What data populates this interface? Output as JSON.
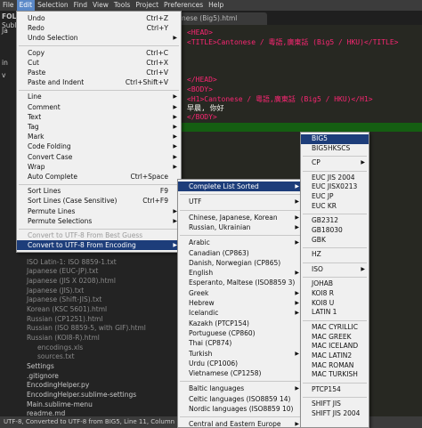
{
  "menubar": [
    "File",
    "Edit",
    "Selection",
    "Find",
    "View",
    "Tools",
    "Project",
    "Preferences",
    "Help"
  ],
  "tab": {
    "title": "nese (Big5).html"
  },
  "sidebar": {
    "folders_label": "FOLD",
    "items": [
      "Subli",
      "Ja",
      "in",
      "v",
      "ISO Latin-1: ISO 8859-1.txt",
      "Japanese (EUC-JP).txt",
      "Japanese (JIS X 0208).html",
      "Japanese (JIS).txt",
      "Japanese (Shift-JIS).txt",
      "Korean (KSC 5601).html",
      "Russian (CP1251).html",
      "Russian (ISO 8859-5, with GIF).html",
      "Russian (KOI8-R).html",
      "encodings.xls",
      "sources.txt",
      "Settings",
      ".gitignore",
      "EncodingHelper.py",
      "EncodingHelper.sublime-settings",
      "Main.sublime-menu",
      "readme.md"
    ]
  },
  "editor": {
    "lines": [
      "<HEAD>",
      "<TITLE>Cantonese / 粵語,廣東話 (Big5 / HKU)</TITLE>",
      "",
      "</HEAD>",
      "<BODY>",
      "<H1>Cantonese / 粵語,廣東話 (Big5 / HKU)</H1>",
      "早晨, 你好",
      "</BODY>"
    ]
  },
  "status": "UTF-8, Converted to UTF-8 from BIG5, Line 11, Column 1",
  "edit_menu": [
    {
      "label": "Undo",
      "sc": "Ctrl+Z"
    },
    {
      "label": "Redo",
      "sc": "Ctrl+Y"
    },
    {
      "label": "Undo Selection",
      "arrow": true
    },
    {
      "sep": true
    },
    {
      "label": "Copy",
      "sc": "Ctrl+C"
    },
    {
      "label": "Cut",
      "sc": "Ctrl+X"
    },
    {
      "label": "Paste",
      "sc": "Ctrl+V"
    },
    {
      "label": "Paste and Indent",
      "sc": "Ctrl+Shift+V"
    },
    {
      "sep": true
    },
    {
      "label": "Line",
      "arrow": true
    },
    {
      "label": "Comment",
      "arrow": true
    },
    {
      "label": "Text",
      "arrow": true
    },
    {
      "label": "Tag",
      "arrow": true
    },
    {
      "label": "Mark",
      "arrow": true
    },
    {
      "label": "Code Folding",
      "arrow": true
    },
    {
      "label": "Convert Case",
      "arrow": true
    },
    {
      "label": "Wrap",
      "arrow": true
    },
    {
      "label": "Auto Complete",
      "sc": "Ctrl+Space"
    },
    {
      "sep": true
    },
    {
      "label": "Sort Lines",
      "sc": "F9"
    },
    {
      "label": "Sort Lines (Case Sensitive)",
      "sc": "Ctrl+F9"
    },
    {
      "label": "Permute Lines",
      "arrow": true
    },
    {
      "label": "Permute Selections",
      "arrow": true
    },
    {
      "sep": true
    },
    {
      "label": "Convert to UTF-8 From Best Guess",
      "disabled": true
    },
    {
      "label": "Convert to UTF-8 From Encoding",
      "arrow": true,
      "highlight": true
    }
  ],
  "sub1": [
    {
      "label": "Complete List Sorted",
      "arrow": true,
      "highlight": true
    },
    {
      "sep": true
    },
    {
      "label": "UTF",
      "arrow": true
    },
    {
      "sep": true
    },
    {
      "label": "Chinese, Japanese, Korean",
      "arrow": true
    },
    {
      "label": "Russian, Ukrainian",
      "arrow": true
    },
    {
      "sep": true
    },
    {
      "label": "Arabic",
      "arrow": true
    },
    {
      "label": "Canadian (CP863)"
    },
    {
      "label": "Danish, Norwegian (CP865)"
    },
    {
      "label": "English",
      "arrow": true
    },
    {
      "label": "Esperanto, Maltese (ISO8859 3)"
    },
    {
      "label": "Greek",
      "arrow": true
    },
    {
      "label": "Hebrew",
      "arrow": true
    },
    {
      "label": "Icelandic",
      "arrow": true
    },
    {
      "label": "Kazakh (PTCP154)"
    },
    {
      "label": "Portuguese (CP860)"
    },
    {
      "label": "Thai (CP874)"
    },
    {
      "label": "Turkish",
      "arrow": true
    },
    {
      "label": "Urdu (CP1006)"
    },
    {
      "label": "Vietnamese (CP1258)"
    },
    {
      "sep": true
    },
    {
      "label": "Baltic languages",
      "arrow": true
    },
    {
      "label": "Celtic languages (ISO8859 14)"
    },
    {
      "label": "Nordic languages (ISO8859 10)"
    },
    {
      "sep": true
    },
    {
      "label": "Central and Eastern Europe",
      "arrow": true
    }
  ],
  "sub2": [
    {
      "label": "BIG5",
      "highlight": true
    },
    {
      "label": "BIG5HKSCS"
    },
    {
      "sep": true
    },
    {
      "label": "CP",
      "arrow": true
    },
    {
      "sep": true
    },
    {
      "label": "EUC JIS 2004"
    },
    {
      "label": "EUC JISX0213"
    },
    {
      "label": "EUC JP"
    },
    {
      "label": "EUC KR"
    },
    {
      "sep": true
    },
    {
      "label": "GB2312"
    },
    {
      "label": "GB18030"
    },
    {
      "label": "GBK"
    },
    {
      "sep": true
    },
    {
      "label": "HZ"
    },
    {
      "sep": true
    },
    {
      "label": "ISO",
      "arrow": true
    },
    {
      "sep": true
    },
    {
      "label": "JOHAB"
    },
    {
      "label": "KOI8 R"
    },
    {
      "label": "KOI8 U"
    },
    {
      "label": "LATIN 1"
    },
    {
      "sep": true
    },
    {
      "label": "MAC CYRILLIC"
    },
    {
      "label": "MAC GREEK"
    },
    {
      "label": "MAC ICELAND"
    },
    {
      "label": "MAC LATIN2"
    },
    {
      "label": "MAC ROMAN"
    },
    {
      "label": "MAC TURKISH"
    },
    {
      "sep": true
    },
    {
      "label": "PTCP154"
    },
    {
      "sep": true
    },
    {
      "label": "SHIFT JIS"
    },
    {
      "label": "SHIFT JIS 2004"
    }
  ]
}
